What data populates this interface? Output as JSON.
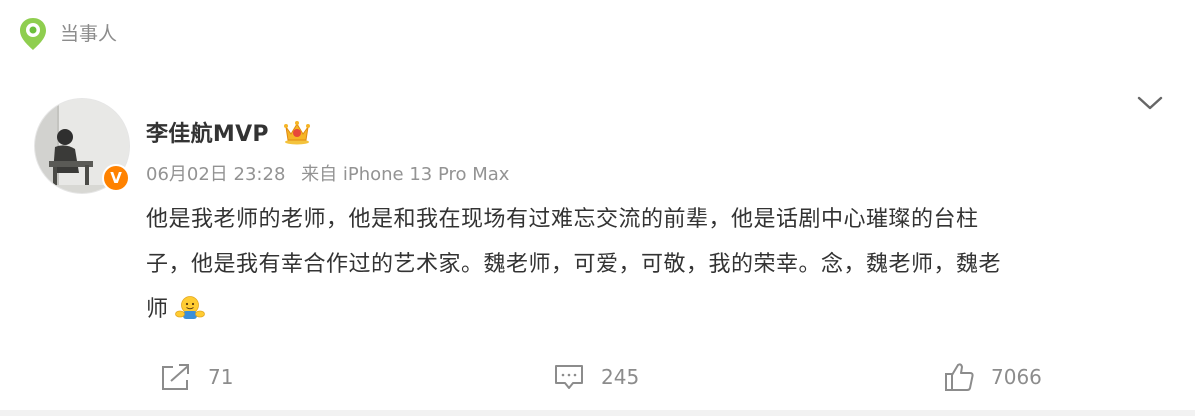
{
  "section": {
    "title": "当事人",
    "icon": "location-pin-icon"
  },
  "post": {
    "author": "李佳航MVP",
    "verified_badge_text": "V",
    "date": "06月02日 23:28",
    "source": "来自 iPhone 13 Pro Max",
    "text_lines": [
      "他是我老师的老师，他是和我在现场有过难忘交流的前辈，他是话剧中心璀璨的台柱",
      "子，他是我有幸合作过的艺术家。魏老师，可爱，可敬，我的荣幸。念，魏老师，魏老",
      "师"
    ],
    "emoji": "hug-emoji"
  },
  "actions": {
    "repost_count": "71",
    "comment_count": "245",
    "like_count": "7066"
  },
  "colors": {
    "accent_green": "#6cbf3b",
    "badge_orange": "#ff8200",
    "muted_text": "#8c8c8c",
    "body_text": "#333333"
  }
}
